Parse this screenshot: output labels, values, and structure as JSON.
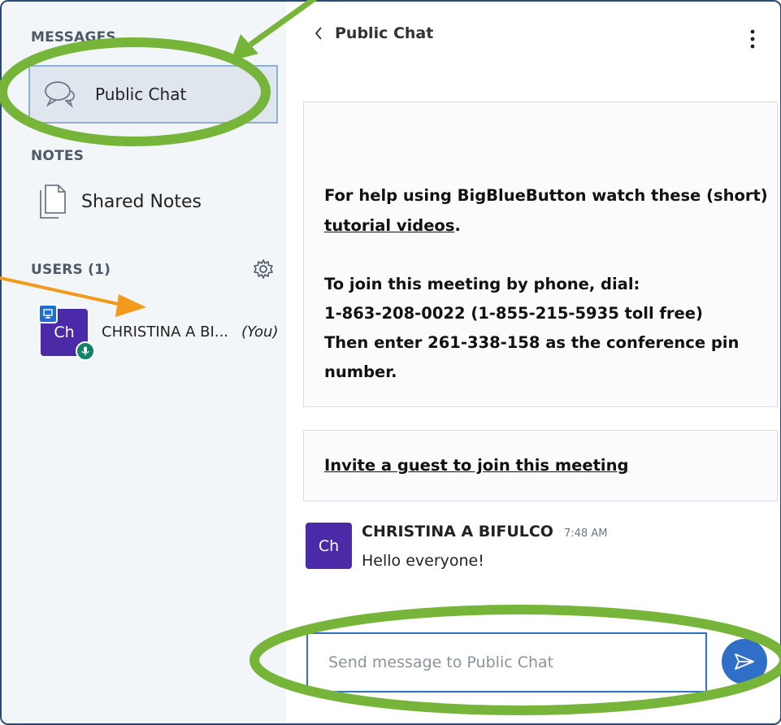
{
  "sidebar": {
    "messages_title": "MESSAGES",
    "public_chat_label": "Public Chat",
    "notes_title": "NOTES",
    "shared_notes_label": "Shared Notes",
    "users_title": "USERS (1)",
    "user": {
      "initials": "Ch",
      "name": "CHRISTINA A BI...",
      "you_tag": "(You)"
    }
  },
  "chat": {
    "title": "Public Chat",
    "welcome": {
      "line1": "For help using BigBlueButton watch these (short)",
      "link": "tutorial videos",
      "link_suffix": ".",
      "line3": "To join this meeting by phone, dial:",
      "line4": "1-863-208-0022 (1-855-215-5935 toll free)",
      "line5": "Then enter 261-338-158 as the conference pin",
      "line6": "number."
    },
    "invite_link": "Invite a guest to join this meeting",
    "message": {
      "initials": "Ch",
      "sender": "CHRISTINA A BIFULCO",
      "time": "7:48 AM",
      "text": "Hello everyone!"
    },
    "input_placeholder": "Send message to Public Chat"
  },
  "colors": {
    "accent": "#2f6fc7",
    "avatar": "#4b2aa8",
    "annotation_circle": "#77b43a",
    "annotation_arrow": "#f39a1c"
  }
}
